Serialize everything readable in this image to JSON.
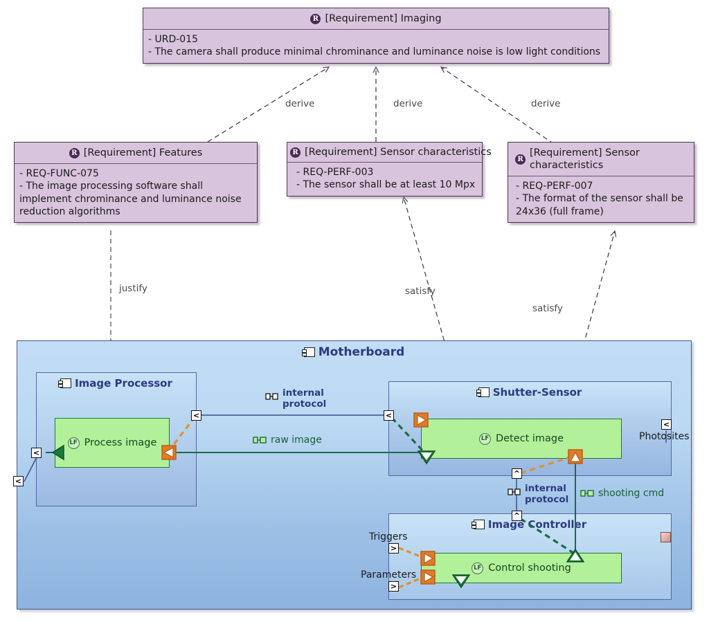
{
  "diagram": {
    "type": "sysml-internal-block-with-requirements",
    "title": "Camera requirements and motherboard internal block diagram"
  },
  "requirements": [
    {
      "id": "imaging",
      "icon": "requirement-icon",
      "icon_letter": "R",
      "stereotype": "[Requirement]",
      "name": "Imaging",
      "header": "[Requirement] Imaging",
      "body": "- URD-015\n- The camera shall produce minimal chrominance and luminance noise is low light conditions"
    },
    {
      "id": "features",
      "icon": "requirement-icon",
      "icon_letter": "R",
      "stereotype": "[Requirement]",
      "name": "Features",
      "header": "[Requirement] Features",
      "body": "- REQ-FUNC-075\n- The image processing software shall implement chrominance and luminance noise reduction algorithms"
    },
    {
      "id": "sensor-characteristics-perf-003",
      "icon": "requirement-icon",
      "icon_letter": "R",
      "stereotype": "[Requirement]",
      "name": "Sensor characteristics",
      "header": "[Requirement] Sensor characteristics",
      "body": "- REQ-PERF-003\n- The sensor shall be at least 10 Mpx"
    },
    {
      "id": "sensor-characteristics-perf-007",
      "icon": "requirement-icon",
      "icon_letter": "R",
      "stereotype": "[Requirement]",
      "name": "Sensor characteristics",
      "header": "[Requirement] Sensor characteristics",
      "body": "- REQ-PERF-007\n- The format of the sensor shall be 24x36 (full frame)"
    }
  ],
  "relations": [
    {
      "id": "derive-1",
      "label": "derive",
      "from": "features",
      "to": "imaging"
    },
    {
      "id": "derive-2",
      "label": "derive",
      "from": "sensor-characteristics-perf-003",
      "to": "imaging"
    },
    {
      "id": "derive-3",
      "label": "derive",
      "from": "sensor-characteristics-perf-007",
      "to": "imaging"
    },
    {
      "id": "justify-1",
      "label": "justify",
      "from": "features",
      "to": "process-image"
    },
    {
      "id": "satisfy-1",
      "label": "satisfy",
      "from": "shutter-sensor",
      "to": "sensor-characteristics-perf-003"
    },
    {
      "id": "satisfy-2",
      "label": "satisfy",
      "from": "shutter-sensor",
      "to": "sensor-characteristics-perf-007"
    }
  ],
  "blocks": {
    "motherboard": {
      "icon": "block-icon",
      "name": "Motherboard"
    },
    "image_processor": {
      "icon": "block-icon",
      "name": "Image Processor",
      "activity": {
        "icon": "lf-icon",
        "icon_letter": "LF",
        "name": "Process image"
      }
    },
    "shutter_sensor": {
      "icon": "block-icon",
      "name": "Shutter-Sensor",
      "activity": {
        "icon": "lf-icon",
        "icon_letter": "LF",
        "name": "Detect image"
      },
      "port_label": "Photosites"
    },
    "image_controller": {
      "icon": "block-icon",
      "name": "Image Controller",
      "activity": {
        "icon": "lf-icon",
        "icon_letter": "LF",
        "name": "Control shooting"
      },
      "port_labels": [
        "Triggers",
        "Parameters"
      ]
    }
  },
  "connector_labels": [
    {
      "id": "internal-protocol-top",
      "text": "internal\nprotocol",
      "icon": "flow-icon",
      "color": "#2b3a80"
    },
    {
      "id": "raw-image",
      "text": "raw image",
      "icon": "flow-icon",
      "color": "#1c5c38"
    },
    {
      "id": "internal-protocol-mid",
      "text": "internal\nprotocol",
      "icon": "flow-icon",
      "color": "#2b3a80"
    },
    {
      "id": "shooting-cmd",
      "text": "shooting cmd",
      "icon": "flow-icon",
      "color": "#1c5c38"
    }
  ],
  "ports": {
    "mb_left_outer": "<",
    "mb_left_inner": "<",
    "ip_right": "<",
    "ss_left": "<",
    "photosites": "<",
    "internal_protocol_upper": "^",
    "internal_protocol_lower": "^",
    "triggers": ">",
    "parameters": ">",
    "mb_right_pink": ""
  },
  "colors": {
    "requirement_fill": "#d9c4dd",
    "requirement_border": "#4a3550",
    "block_border": "#46578e",
    "block_title": "#2b3a80",
    "activity_fill": "#b3f09a",
    "activity_border": "#1e7a33",
    "motherboard_fill_top": "#bfdcf5",
    "motherboard_fill_bottom": "#7fa8d8",
    "orange_connector": "#e09030",
    "green_connector": "#1a6b46",
    "blue_connector": "#3a4f8c",
    "dashed_relation": "#4a4050"
  }
}
